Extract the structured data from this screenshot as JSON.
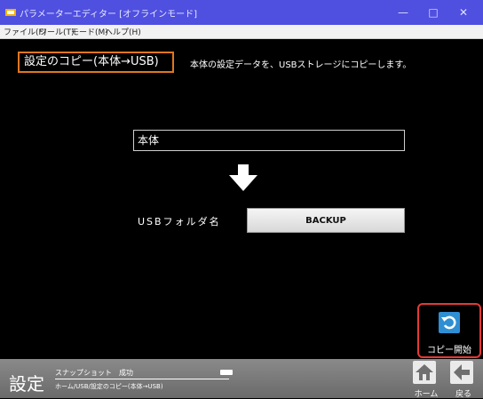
{
  "window": {
    "title": "パラメーターエディター [オフラインモード]",
    "controls": {
      "minimize": "—",
      "maximize": "□",
      "close": "✕"
    }
  },
  "menu": [
    "ファイル(F)",
    "ツール(T)",
    "モード(M)",
    "ヘルプ(H)"
  ],
  "page": {
    "heading": "設定のコピー(本体→USB)",
    "description": "本体の設定データを、USBストレージにコピーします。",
    "source_label": "本体",
    "folder_label": "USBフォルダ名",
    "folder_value": "BACKUP",
    "start_label": "コピー開始"
  },
  "footer": {
    "title": "設定",
    "status_text": "スナップショット　成功",
    "breadcrumb": "ホーム/USB/設定のコピー(本体→USB)",
    "home_label": "ホーム",
    "back_label": "戻る"
  },
  "icons": {
    "app": "app-icon",
    "arrow": "arrow-down-icon",
    "start": "refresh-icon",
    "home": "home-icon",
    "back": "back-arrow-icon"
  },
  "colors": {
    "titlebar": "#4f4fe0",
    "heading_border": "#e0771e",
    "start_border": "#e53935",
    "start_icon": "#2f8fd3",
    "footer": "#7a7a7a"
  }
}
